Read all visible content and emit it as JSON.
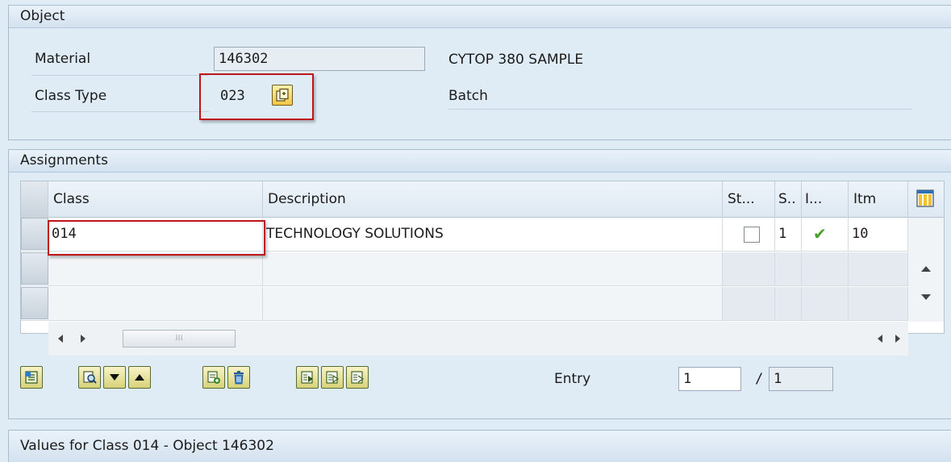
{
  "object_group": {
    "title": "Object",
    "material_label": "Material",
    "material_value": "146302",
    "material_desc": "CYTOP 380 SAMPLE",
    "class_type_label": "Class Type",
    "class_type_value": "023",
    "class_type_desc": "Batch"
  },
  "assignments": {
    "title": "Assignments",
    "columns": [
      "Class",
      "Description",
      "St...",
      "S..",
      "I...",
      "Itm"
    ],
    "rows": [
      {
        "class": "014",
        "description": "TECHNOLOGY SOLUTIONS",
        "status_checked": false,
        "s": "1",
        "i": "✔",
        "itm": "10"
      },
      {
        "class": "",
        "description": "",
        "s": "",
        "i": "",
        "itm": ""
      },
      {
        "class": "",
        "description": "",
        "s": "",
        "i": "",
        "itm": ""
      }
    ],
    "entry_label": "Entry",
    "entry_value": "1",
    "entry_sep": "/",
    "entry_total": "1"
  },
  "values_group": {
    "title": "Values for Class 014 - Object 146302"
  },
  "colors": {
    "background": "#dfebf5",
    "highlight_red": "#c0141c",
    "check_green": "#4aa02c"
  },
  "icons": {
    "class_type_button": "copy-document-icon",
    "table_settings": "column-layout-icon"
  }
}
